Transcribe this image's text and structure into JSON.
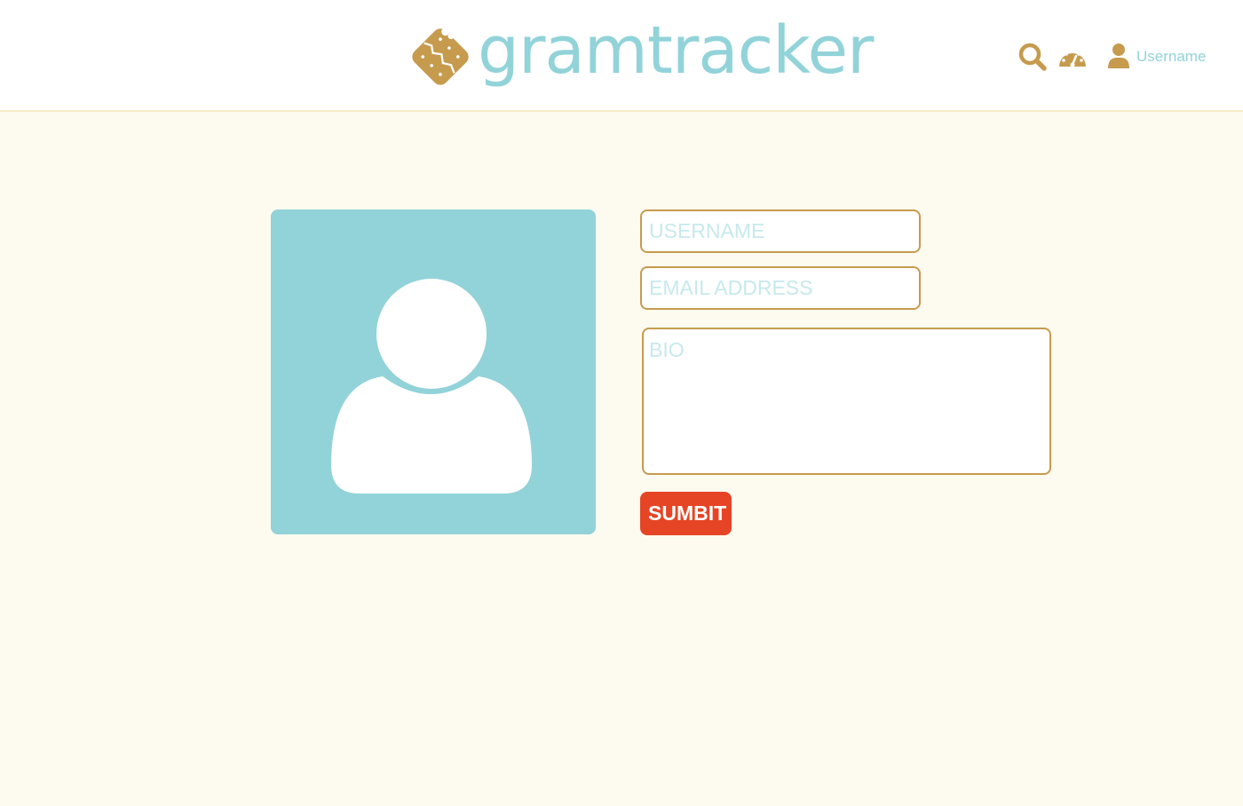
{
  "header": {
    "logo_text": "gramtracker",
    "nav": {
      "search_icon": "search-icon",
      "dashboard_icon": "dashboard-gauge-icon",
      "user_icon": "user-icon",
      "username_label": "Username"
    }
  },
  "profile_form": {
    "avatar_icon": "default-avatar-icon",
    "username": {
      "value": "",
      "placeholder": "USERNAME"
    },
    "email": {
      "value": "",
      "placeholder": "EMAIL ADDRESS"
    },
    "bio": {
      "value": "",
      "placeholder": "BIO"
    },
    "submit_label": "SUMBIT"
  },
  "colors": {
    "brand_teal": "#92d3d9",
    "brand_gold": "#c69b4e",
    "page_background": "#fdfaef",
    "submit_red": "#e64525"
  }
}
